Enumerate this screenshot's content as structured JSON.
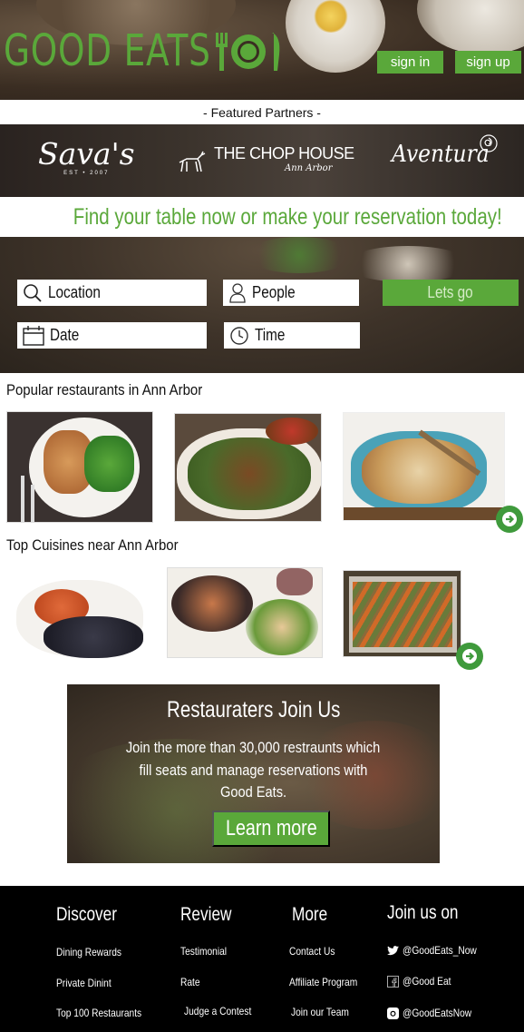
{
  "brand": {
    "logo_text": "GOOD EATS",
    "accent": "#5aa83a"
  },
  "header": {
    "sign_in": "sign in",
    "sign_up": "sign up"
  },
  "partners": {
    "label": "- Featured Partners -",
    "items": [
      {
        "name": "Sava's",
        "sub": "EST • 2007"
      },
      {
        "name": "THE CHOP HOUSE",
        "sub": "Ann Arbor"
      },
      {
        "name": "Aventura"
      }
    ]
  },
  "tagline": "Find your table now or make your reservation today!",
  "search": {
    "location": "Location",
    "people": "People",
    "date": "Date",
    "time": "Time",
    "submit": "Lets go"
  },
  "popular": {
    "title": "Popular restaurants in Ann Arbor"
  },
  "cuisines": {
    "title": "Top Cuisines near Ann Arbor"
  },
  "join": {
    "title": "Restauraters Join Us",
    "line1": "Join the more than 30,000 restraunts which",
    "line2": "fill seats and manage reservations with",
    "line3": "Good Eats.",
    "button": "Learn more"
  },
  "footer": {
    "discover": {
      "title": "Discover",
      "links": [
        "Dining Rewards",
        "Private Dinint",
        "Top 100 Restaurants"
      ]
    },
    "review": {
      "title": "Review",
      "links": [
        "Testimonial",
        "Rate",
        "Judge a Contest"
      ]
    },
    "more": {
      "title": "More",
      "links": [
        "Contact Us",
        "Affiliate Program",
        "Join our Team"
      ]
    },
    "join": {
      "title": "Join us on",
      "twitter": "@GoodEats_Now",
      "facebook": "@Good Eat",
      "instagram": "@GoodEatsNow"
    }
  }
}
